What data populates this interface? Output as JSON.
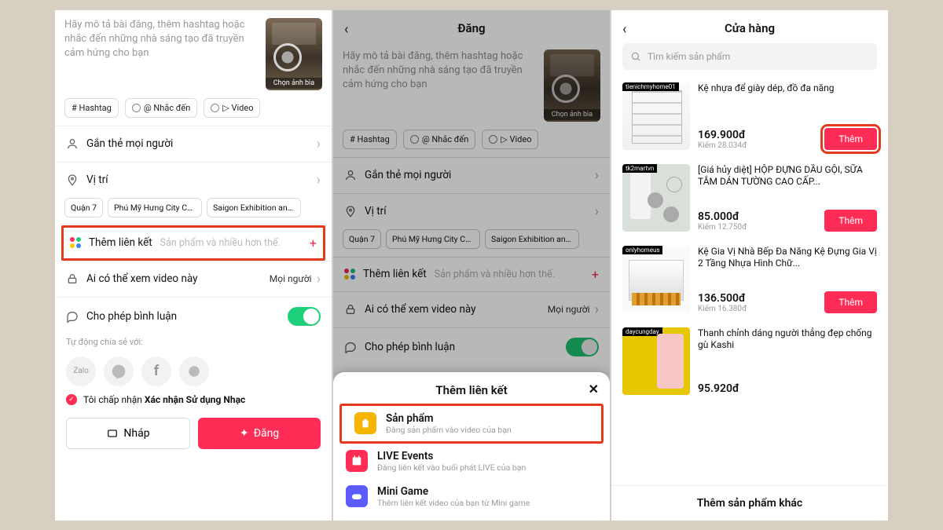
{
  "colors": {
    "accent": "#ff2d55",
    "highlight_border": "#e43a1d",
    "toggle_on": "#1fd07b"
  },
  "screen1": {
    "description_placeholder": "Hãy mô tả bài đăng, thêm hashtag hoặc nhắc đến những nhà sáng tạo đã truyền cảm hứng cho bạn",
    "cover_label": "Chọn ảnh bìa",
    "chips": [
      "# Hashtag",
      "@ Nhắc đến",
      "▷ Video"
    ],
    "row_tag_people": "Gắn thẻ mọi người",
    "row_location": "Vị trí",
    "location_suggestions": [
      "Quận 7",
      "Phú Mỹ Hưng City Ce...",
      "Saigon Exhibition and..."
    ],
    "row_add_link": "Thêm liên kết",
    "row_add_link_hint": "Sản phẩm và nhiều hơn thế.",
    "row_who_can_view": "Ai có thể xem video này",
    "who_value": "Mọi người",
    "row_allow_comments": "Cho phép bình luận",
    "auto_share_label": "Tự động chia sẻ với:",
    "share_icons": [
      "Zalo",
      "Messenger",
      "Facebook",
      "Chat"
    ],
    "accept_prefix": "Tôi chấp nhận ",
    "accept_bold": "Xác nhận Sử dụng Nhạc",
    "btn_draft": "Nháp",
    "btn_post": "Đăng"
  },
  "screen2": {
    "header": "Đăng",
    "sheet_title": "Thêm liên kết",
    "items": [
      {
        "title": "Sản phẩm",
        "sub": "Đăng sản phẩm vào video của bạn"
      },
      {
        "title": "LIVE Events",
        "sub": "Đăng liên kết vào buổi phát LIVE của bạn"
      },
      {
        "title": "Mini Game",
        "sub": "Thêm liên kết video của bạn từ Mini game"
      }
    ]
  },
  "screen3": {
    "header": "Cửa hàng",
    "search_placeholder": "Tìm kiếm sản phẩm",
    "btn_add": "Thêm",
    "bottom_add_more": "Thêm sản phẩm khác",
    "products": [
      {
        "tag": "tienichmyhome01",
        "name": "Kệ nhựa để giày dép, đồ đa năng",
        "price": "169.900đ",
        "earn": "Kiếm 28.034đ"
      },
      {
        "tag": "tk2martvn",
        "name": "[Giá hủy diệt] HỘP ĐỰNG DẦU GỘI, SỮA TẮM DÁN TƯỜNG CAO CẤP...",
        "price": "85.000đ",
        "earn": "Kiếm 12.750đ"
      },
      {
        "tag": "onlyhomeus",
        "name": "Kệ Gia Vị Nhà Bếp Đa Năng Kệ Đựng Gia Vị 2 Tầng Nhựa Hình Chữ...",
        "price": "136.500đ",
        "earn": "Kiếm 16.380đ"
      },
      {
        "tag": "daycungday",
        "name": "Thanh chỉnh dáng người thẳng đẹp chống gù Kashi",
        "price": "95.920đ",
        "earn": ""
      }
    ]
  }
}
